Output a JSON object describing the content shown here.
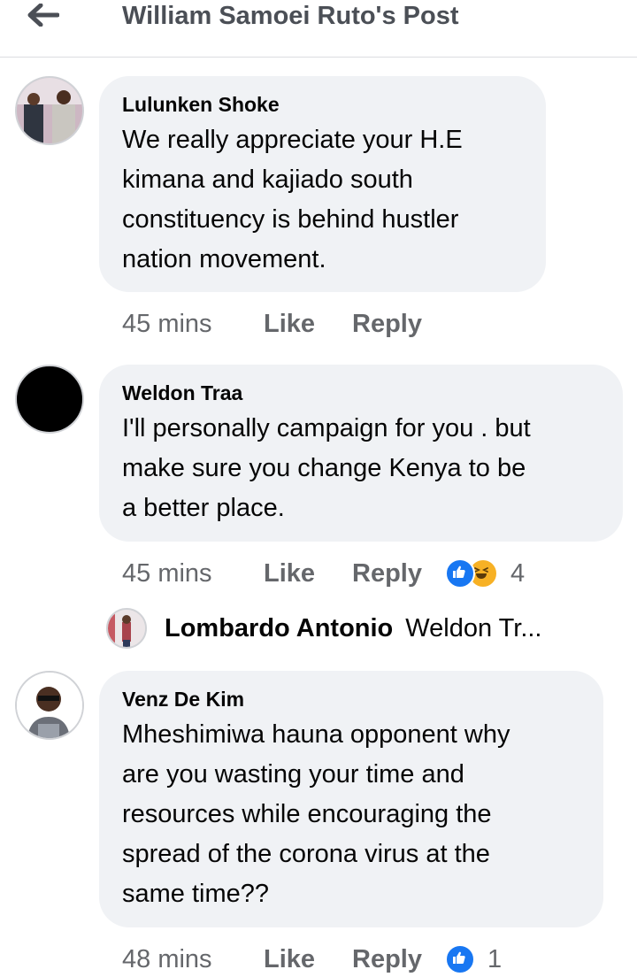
{
  "header": {
    "back_icon": "arrow-left-icon",
    "title": "William Samoei Ruto's Post"
  },
  "actions": {
    "like_label": "Like",
    "reply_label": "Reply"
  },
  "comments": [
    {
      "author": "Lulunken Shoke",
      "lines": [
        "We really appreciate your H.E",
        "kimana and kajiado south",
        "constituency is behind hustler",
        "nation movement."
      ],
      "time": "45 mins"
    },
    {
      "author": "Weldon Traa",
      "lines": [
        "I'll personally campaign for you . but",
        "make sure you change Kenya to be",
        "a better place."
      ],
      "time": "45 mins",
      "reactions": {
        "icons": [
          "like-reaction-icon",
          "haha-reaction-icon"
        ],
        "count": "4"
      },
      "reply_preview": {
        "author": "Lombardo Antonio",
        "snippet": "Weldon Tr..."
      }
    },
    {
      "author": "Venz De Kim",
      "lines": [
        "Mheshimiwa hauna opponent why",
        "are you wasting your time and",
        "resources while encouraging the",
        "spread of the corona virus at the",
        "same time??"
      ],
      "time": "48 mins",
      "reactions": {
        "icons": [
          "like-reaction-icon"
        ],
        "count": "1"
      }
    }
  ],
  "colors": {
    "bubble": "#f0f2f5",
    "meta_text": "#65676b",
    "like_reaction": "#1877f2",
    "haha_reaction": "#f7b125"
  }
}
